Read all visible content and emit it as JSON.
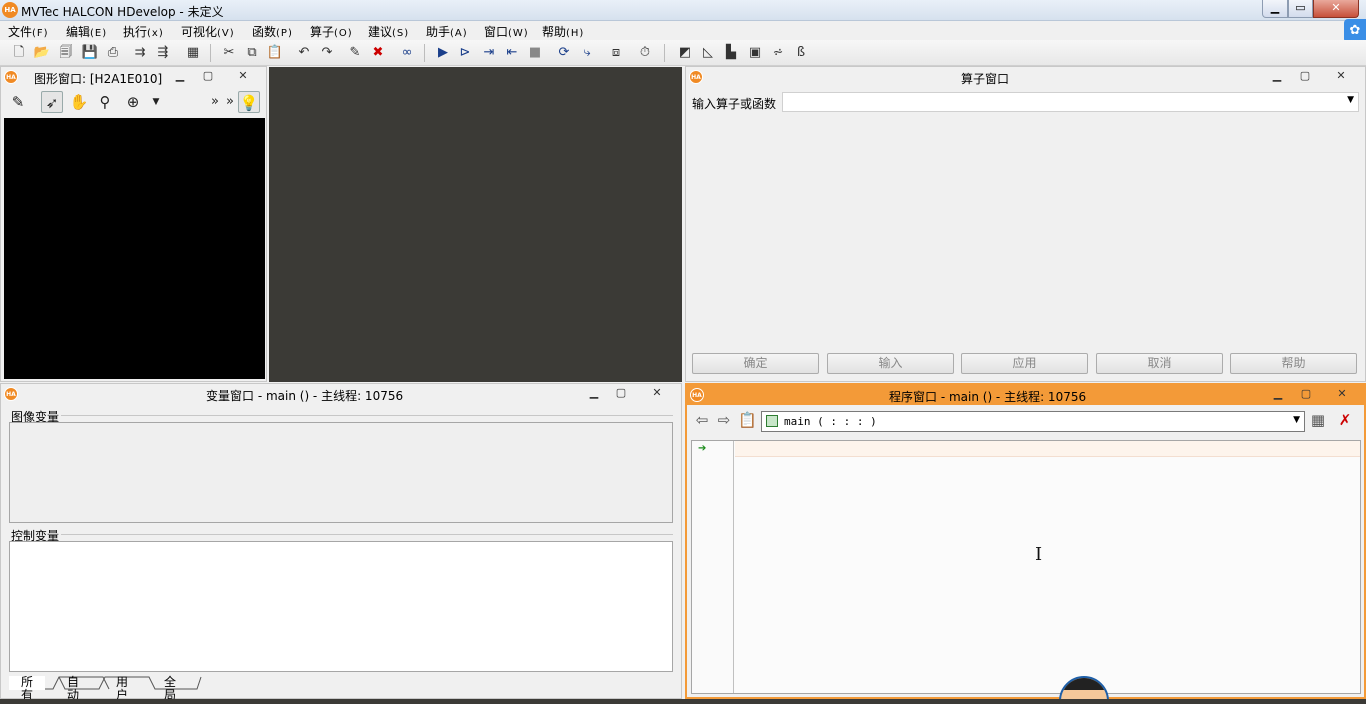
{
  "window": {
    "app_icon": "HA",
    "title": "MVTec HALCON HDevelop - 未定义",
    "controls": [
      "minimize-icon",
      "maximize-icon",
      "close-icon"
    ]
  },
  "menubar": {
    "items": [
      {
        "label": "文件",
        "accel": "(F)"
      },
      {
        "label": "编辑",
        "accel": "(E)"
      },
      {
        "label": "执行",
        "accel": "(x)"
      },
      {
        "label": "可视化",
        "accel": "(V)"
      },
      {
        "label": "函数",
        "accel": "(P)"
      },
      {
        "label": "算子",
        "accel": "(O)"
      },
      {
        "label": "建议",
        "accel": "(S)"
      },
      {
        "label": "助手",
        "accel": "(A)"
      },
      {
        "label": "窗口",
        "accel": "(W)"
      },
      {
        "label": "帮助",
        "accel": "(H)"
      }
    ]
  },
  "toolbar": {
    "icons": [
      "new-file-icon",
      "open-file-icon",
      "open-example-icon",
      "save-icon",
      "print-icon",
      "export-icon",
      "import-icon",
      "insert-image-icon",
      "cut-icon",
      "copy-icon",
      "paste-icon",
      "undo-icon",
      "redo-icon",
      "activate-icon",
      "deactivate-icon",
      "zoom-binoculars-icon",
      "run-icon",
      "step-over-icon",
      "step-forward-icon",
      "step-back-icon",
      "stop-icon",
      "reset-icon",
      "execute-icon",
      "step-procedure-icon",
      "timer-icon",
      "graphics-icon",
      "histogram-icon",
      "line-profile-icon",
      "region-features-icon",
      "gray-histogram-icon",
      "ocr-icon"
    ]
  },
  "graphics_window": {
    "title": "图形窗口: [H2A1E010]",
    "tools": [
      "edit-icon",
      "pointer-icon",
      "hand-icon",
      "zoom-icon",
      "magnify-icon",
      "more-icon",
      "expand-icon",
      "light-bulb-icon"
    ]
  },
  "operator_window": {
    "title": "算子窗口",
    "input_label": "输入算子或函数",
    "input_value": "",
    "buttons": [
      "确定",
      "输入",
      "应用",
      "取消",
      "帮助"
    ]
  },
  "variable_window": {
    "title": "变量窗口 - main () - 主线程: 10756",
    "image_vars_label": "图像变量",
    "control_vars_label": "控制变量",
    "tabs": [
      "所有",
      "自动",
      "用户",
      "全局"
    ]
  },
  "program_window": {
    "title": "程序窗口 - main () - 主线程: 10756",
    "procedure": "main ( : : : )",
    "accent_color": "#f39a38"
  }
}
